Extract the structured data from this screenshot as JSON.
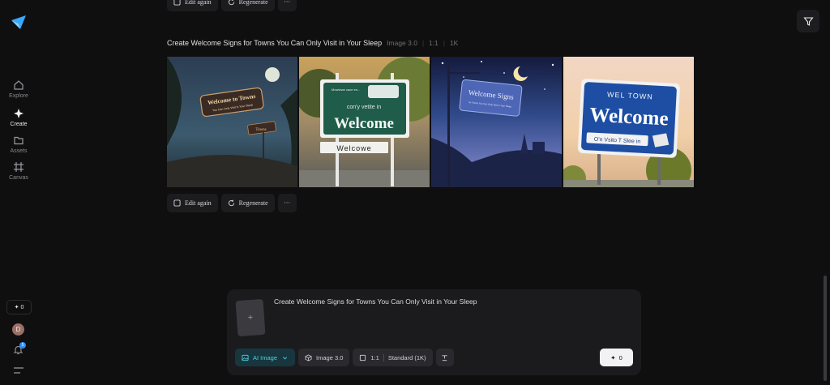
{
  "sidebar": {
    "items": [
      {
        "label": "Explore",
        "icon": "home-icon"
      },
      {
        "label": "Create",
        "icon": "sparkle-icon"
      },
      {
        "label": "Assets",
        "icon": "folder-icon"
      },
      {
        "label": "Canvas",
        "icon": "canvas-frame-icon"
      }
    ],
    "credits": "0",
    "avatar_initial": "D",
    "notification_count": "5"
  },
  "actions": {
    "edit_again": "Edit again",
    "regenerate": "Regenerate",
    "more": "···"
  },
  "generation": {
    "title": "Create Welcome Signs for Towns You Can Only Visit in Your Sleep",
    "model": "Image 3.0",
    "ratio": "1:1",
    "resolution": "1K",
    "images": [
      {
        "sign_line1": "Welcome to Towns",
        "sign_line2": "You Can Only Visit in Your Sleep",
        "sign_small": "Towns"
      },
      {
        "sign_top": "Mowtowe cace en...",
        "sign_line1": "con'y vetite in",
        "sign_line2": "Welcome",
        "sign_small": "Welcowe"
      },
      {
        "sign_line1": "Welcome Signs",
        "sign_line2": "for Towns You Can Only Visit in Your Sleep"
      },
      {
        "sign_top": "WEL TOWN",
        "sign_line1": "Welcome",
        "sign_line2": "O'n Vsito T Slee in"
      }
    ]
  },
  "prompt": {
    "text": "Create Welcome Signs for Towns You Can Only Visit in Your Sleep",
    "mode": "AI Image",
    "model": "Image 3.0",
    "ratio": "1:1",
    "quality": "Standard (1K)",
    "generate_credits": "0"
  },
  "colors": {
    "background": "#0f0f10",
    "accent": "#4fd0e6",
    "panel": "#1b1b1e"
  }
}
